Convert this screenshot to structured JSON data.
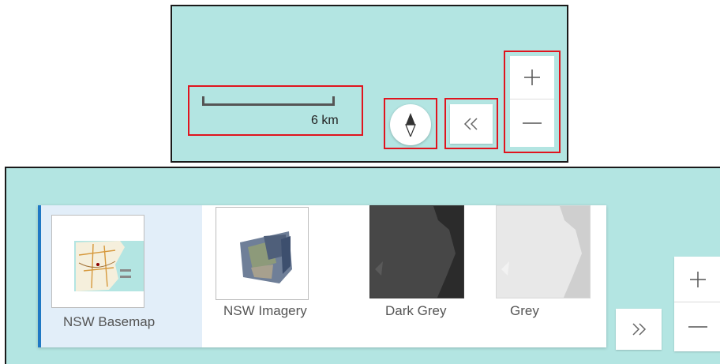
{
  "map_controls": {
    "scale_label": "6 km",
    "compass_icon": "compass-icon",
    "collapse_icon": "double-chevron-left-icon",
    "zoom_in_icon": "plus-icon",
    "zoom_out_icon": "minus-icon"
  },
  "basemap_gallery": {
    "items": [
      {
        "label": "NSW Basemap",
        "selected": true
      },
      {
        "label": "NSW Imagery",
        "selected": false
      },
      {
        "label": "Dark Grey",
        "selected": false
      },
      {
        "label": "Grey",
        "selected": false
      }
    ],
    "expand_icon": "double-chevron-right-icon",
    "zoom_in_icon": "plus-icon",
    "zoom_out_icon": "minus-icon"
  },
  "colors": {
    "map_background": "#b3e5e2",
    "highlight": "#e0141e",
    "selected_bg": "#e2eef9",
    "selected_accent": "#1f78c4"
  }
}
